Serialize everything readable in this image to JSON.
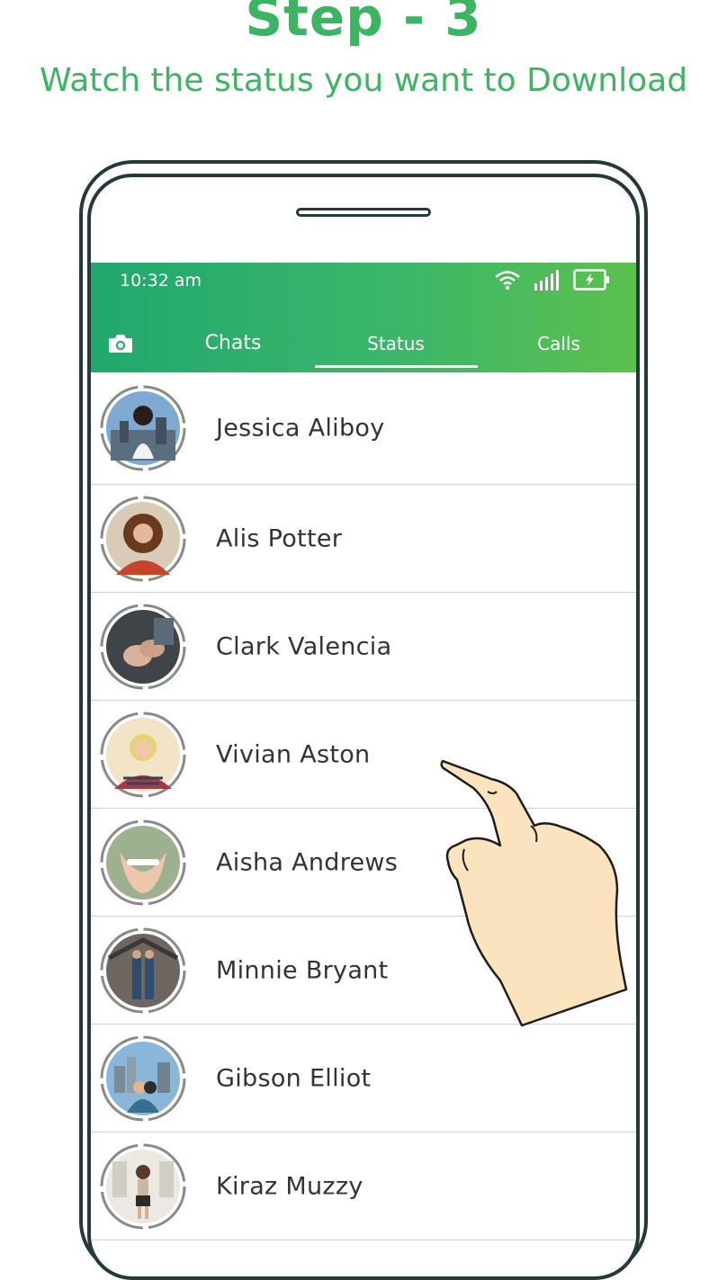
{
  "header": {
    "title": "Step - 3",
    "subtitle": "Watch the status you want to Download"
  },
  "status_bar": {
    "time": "10:32 am",
    "icons": [
      "wifi-icon",
      "signal-icon",
      "battery-charging-icon"
    ]
  },
  "tabs": {
    "camera_icon": "camera-icon",
    "chats": "Chats",
    "status": "Status",
    "calls": "Calls",
    "active": "Status"
  },
  "colors": {
    "accent": "#3cb563",
    "header_gradient_start": "#21a86d",
    "header_gradient_end": "#5cc04e",
    "phone_frame": "#24393c"
  },
  "contacts": [
    {
      "name": "Jessica Aliboy"
    },
    {
      "name": "Alis Potter"
    },
    {
      "name": "Clark Valencia"
    },
    {
      "name": "Vivian Aston"
    },
    {
      "name": "Aisha Andrews"
    },
    {
      "name": "Minnie Bryant"
    },
    {
      "name": "Gibson Elliot"
    },
    {
      "name": "Kiraz Muzzy"
    }
  ]
}
